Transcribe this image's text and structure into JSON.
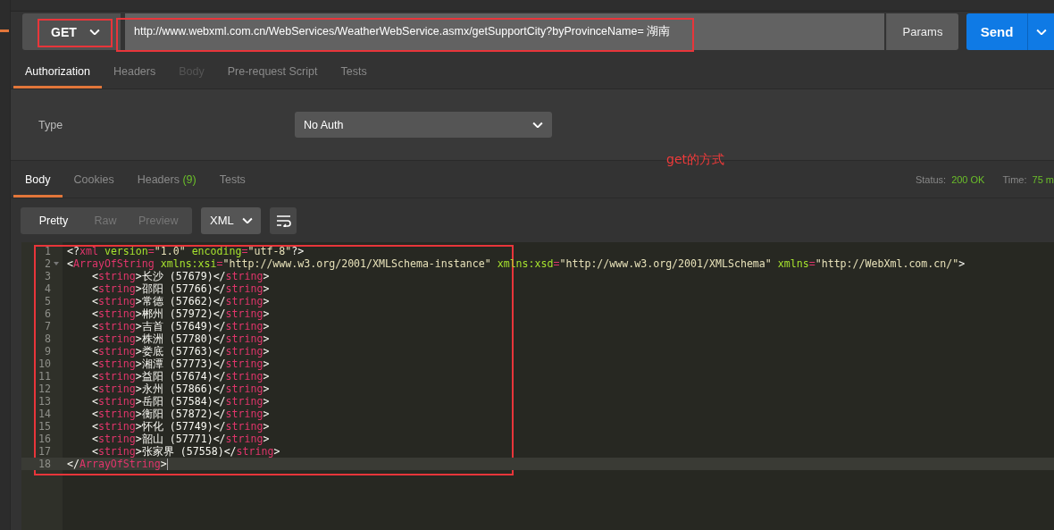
{
  "request": {
    "method": "GET",
    "method_highlighted": true,
    "url": "http://www.webxml.com.cn/WebServices/WeatherWebService.asmx/getSupportCity?byProvinceName= 湖南",
    "url_highlighted": true,
    "params_label": "Params",
    "send_label": "Send"
  },
  "request_tabs": [
    {
      "label": "Authorization",
      "selected": true,
      "disabled": false
    },
    {
      "label": "Headers",
      "selected": false,
      "disabled": false
    },
    {
      "label": "Body",
      "selected": false,
      "disabled": true
    },
    {
      "label": "Pre-request Script",
      "selected": false,
      "disabled": false
    },
    {
      "label": "Tests",
      "selected": false,
      "disabled": false
    }
  ],
  "authorization": {
    "type_label": "Type",
    "type_value": "No Auth"
  },
  "note": "get的方式",
  "response_tabs": [
    {
      "label": "Body",
      "selected": true
    },
    {
      "label": "Cookies",
      "selected": false
    },
    {
      "label": "Headers",
      "count": "(9)",
      "selected": false
    },
    {
      "label": "Tests",
      "selected": false
    }
  ],
  "status": {
    "status_label": "Status:",
    "status_value": "200 OK",
    "time_label": "Time:",
    "time_value": "75 m"
  },
  "view_modes": [
    {
      "label": "Pretty",
      "selected": true
    },
    {
      "label": "Raw",
      "selected": false
    },
    {
      "label": "Preview",
      "selected": false
    }
  ],
  "format": "XML",
  "editor": {
    "highlighted": true,
    "lines": [
      {
        "number": "1",
        "foldable": false,
        "current": false,
        "tokens": [
          {
            "kind": "punct",
            "text": "<?"
          },
          {
            "kind": "tag",
            "text": "xml"
          },
          {
            "kind": "attr",
            "text": " version"
          },
          {
            "kind": "eq",
            "text": "="
          },
          {
            "kind": "value",
            "text": "\"1.0\""
          },
          {
            "kind": "attr",
            "text": " encoding"
          },
          {
            "kind": "eq",
            "text": "="
          },
          {
            "kind": "value",
            "text": "\"utf-8\""
          },
          {
            "kind": "punct",
            "text": "?>"
          }
        ]
      },
      {
        "number": "2",
        "foldable": true,
        "current": false,
        "tokens": [
          {
            "kind": "punct",
            "text": "<"
          },
          {
            "kind": "tag",
            "text": "ArrayOfString"
          },
          {
            "kind": "attr",
            "text": " xmlns:xsi"
          },
          {
            "kind": "eq",
            "text": "="
          },
          {
            "kind": "value",
            "text": "\"http://www.w3.org/2001/XMLSchema-instance\""
          },
          {
            "kind": "attr",
            "text": " xmlns:xsd"
          },
          {
            "kind": "eq",
            "text": "="
          },
          {
            "kind": "value",
            "text": "\"http://www.w3.org/2001/XMLSchema\""
          },
          {
            "kind": "attr",
            "text": " xmlns"
          },
          {
            "kind": "eq",
            "text": "="
          },
          {
            "kind": "value",
            "text": "\"http://WebXml.com.cn/\""
          },
          {
            "kind": "punct",
            "text": ">"
          }
        ]
      },
      {
        "number": "3",
        "foldable": false,
        "current": false,
        "tokens": [
          {
            "kind": "punct",
            "text": "    <"
          },
          {
            "kind": "tag",
            "text": "string"
          },
          {
            "kind": "punct",
            "text": ">"
          },
          {
            "kind": "text",
            "text": "长沙 (57679)"
          },
          {
            "kind": "punct",
            "text": "</"
          },
          {
            "kind": "tag",
            "text": "string"
          },
          {
            "kind": "punct",
            "text": ">"
          }
        ]
      },
      {
        "number": "4",
        "foldable": false,
        "current": false,
        "tokens": [
          {
            "kind": "punct",
            "text": "    <"
          },
          {
            "kind": "tag",
            "text": "string"
          },
          {
            "kind": "punct",
            "text": ">"
          },
          {
            "kind": "text",
            "text": "邵阳 (57766)"
          },
          {
            "kind": "punct",
            "text": "</"
          },
          {
            "kind": "tag",
            "text": "string"
          },
          {
            "kind": "punct",
            "text": ">"
          }
        ]
      },
      {
        "number": "5",
        "foldable": false,
        "current": false,
        "tokens": [
          {
            "kind": "punct",
            "text": "    <"
          },
          {
            "kind": "tag",
            "text": "string"
          },
          {
            "kind": "punct",
            "text": ">"
          },
          {
            "kind": "text",
            "text": "常德 (57662)"
          },
          {
            "kind": "punct",
            "text": "</"
          },
          {
            "kind": "tag",
            "text": "string"
          },
          {
            "kind": "punct",
            "text": ">"
          }
        ]
      },
      {
        "number": "6",
        "foldable": false,
        "current": false,
        "tokens": [
          {
            "kind": "punct",
            "text": "    <"
          },
          {
            "kind": "tag",
            "text": "string"
          },
          {
            "kind": "punct",
            "text": ">"
          },
          {
            "kind": "text",
            "text": "郴州 (57972)"
          },
          {
            "kind": "punct",
            "text": "</"
          },
          {
            "kind": "tag",
            "text": "string"
          },
          {
            "kind": "punct",
            "text": ">"
          }
        ]
      },
      {
        "number": "7",
        "foldable": false,
        "current": false,
        "tokens": [
          {
            "kind": "punct",
            "text": "    <"
          },
          {
            "kind": "tag",
            "text": "string"
          },
          {
            "kind": "punct",
            "text": ">"
          },
          {
            "kind": "text",
            "text": "吉首 (57649)"
          },
          {
            "kind": "punct",
            "text": "</"
          },
          {
            "kind": "tag",
            "text": "string"
          },
          {
            "kind": "punct",
            "text": ">"
          }
        ]
      },
      {
        "number": "8",
        "foldable": false,
        "current": false,
        "tokens": [
          {
            "kind": "punct",
            "text": "    <"
          },
          {
            "kind": "tag",
            "text": "string"
          },
          {
            "kind": "punct",
            "text": ">"
          },
          {
            "kind": "text",
            "text": "株洲 (57780)"
          },
          {
            "kind": "punct",
            "text": "</"
          },
          {
            "kind": "tag",
            "text": "string"
          },
          {
            "kind": "punct",
            "text": ">"
          }
        ]
      },
      {
        "number": "9",
        "foldable": false,
        "current": false,
        "tokens": [
          {
            "kind": "punct",
            "text": "    <"
          },
          {
            "kind": "tag",
            "text": "string"
          },
          {
            "kind": "punct",
            "text": ">"
          },
          {
            "kind": "text",
            "text": "娄底 (57763)"
          },
          {
            "kind": "punct",
            "text": "</"
          },
          {
            "kind": "tag",
            "text": "string"
          },
          {
            "kind": "punct",
            "text": ">"
          }
        ]
      },
      {
        "number": "10",
        "foldable": false,
        "current": false,
        "tokens": [
          {
            "kind": "punct",
            "text": "    <"
          },
          {
            "kind": "tag",
            "text": "string"
          },
          {
            "kind": "punct",
            "text": ">"
          },
          {
            "kind": "text",
            "text": "湘潭 (57773)"
          },
          {
            "kind": "punct",
            "text": "</"
          },
          {
            "kind": "tag",
            "text": "string"
          },
          {
            "kind": "punct",
            "text": ">"
          }
        ]
      },
      {
        "number": "11",
        "foldable": false,
        "current": false,
        "tokens": [
          {
            "kind": "punct",
            "text": "    <"
          },
          {
            "kind": "tag",
            "text": "string"
          },
          {
            "kind": "punct",
            "text": ">"
          },
          {
            "kind": "text",
            "text": "益阳 (57674)"
          },
          {
            "kind": "punct",
            "text": "</"
          },
          {
            "kind": "tag",
            "text": "string"
          },
          {
            "kind": "punct",
            "text": ">"
          }
        ]
      },
      {
        "number": "12",
        "foldable": false,
        "current": false,
        "tokens": [
          {
            "kind": "punct",
            "text": "    <"
          },
          {
            "kind": "tag",
            "text": "string"
          },
          {
            "kind": "punct",
            "text": ">"
          },
          {
            "kind": "text",
            "text": "永州 (57866)"
          },
          {
            "kind": "punct",
            "text": "</"
          },
          {
            "kind": "tag",
            "text": "string"
          },
          {
            "kind": "punct",
            "text": ">"
          }
        ]
      },
      {
        "number": "13",
        "foldable": false,
        "current": false,
        "tokens": [
          {
            "kind": "punct",
            "text": "    <"
          },
          {
            "kind": "tag",
            "text": "string"
          },
          {
            "kind": "punct",
            "text": ">"
          },
          {
            "kind": "text",
            "text": "岳阳 (57584)"
          },
          {
            "kind": "punct",
            "text": "</"
          },
          {
            "kind": "tag",
            "text": "string"
          },
          {
            "kind": "punct",
            "text": ">"
          }
        ]
      },
      {
        "number": "14",
        "foldable": false,
        "current": false,
        "tokens": [
          {
            "kind": "punct",
            "text": "    <"
          },
          {
            "kind": "tag",
            "text": "string"
          },
          {
            "kind": "punct",
            "text": ">"
          },
          {
            "kind": "text",
            "text": "衡阳 (57872)"
          },
          {
            "kind": "punct",
            "text": "</"
          },
          {
            "kind": "tag",
            "text": "string"
          },
          {
            "kind": "punct",
            "text": ">"
          }
        ]
      },
      {
        "number": "15",
        "foldable": false,
        "current": false,
        "tokens": [
          {
            "kind": "punct",
            "text": "    <"
          },
          {
            "kind": "tag",
            "text": "string"
          },
          {
            "kind": "punct",
            "text": ">"
          },
          {
            "kind": "text",
            "text": "怀化 (57749)"
          },
          {
            "kind": "punct",
            "text": "</"
          },
          {
            "kind": "tag",
            "text": "string"
          },
          {
            "kind": "punct",
            "text": ">"
          }
        ]
      },
      {
        "number": "16",
        "foldable": false,
        "current": false,
        "tokens": [
          {
            "kind": "punct",
            "text": "    <"
          },
          {
            "kind": "tag",
            "text": "string"
          },
          {
            "kind": "punct",
            "text": ">"
          },
          {
            "kind": "text",
            "text": "韶山 (57771)"
          },
          {
            "kind": "punct",
            "text": "</"
          },
          {
            "kind": "tag",
            "text": "string"
          },
          {
            "kind": "punct",
            "text": ">"
          }
        ]
      },
      {
        "number": "17",
        "foldable": false,
        "current": false,
        "tokens": [
          {
            "kind": "punct",
            "text": "    <"
          },
          {
            "kind": "tag",
            "text": "string"
          },
          {
            "kind": "punct",
            "text": ">"
          },
          {
            "kind": "text",
            "text": "张家界 (57558)"
          },
          {
            "kind": "punct",
            "text": "</"
          },
          {
            "kind": "tag",
            "text": "string"
          },
          {
            "kind": "punct",
            "text": ">"
          }
        ]
      },
      {
        "number": "18",
        "foldable": false,
        "current": true,
        "tokens": [
          {
            "kind": "punct",
            "text": "</"
          },
          {
            "kind": "tag",
            "text": "ArrayOfString"
          },
          {
            "kind": "punct",
            "text": ">"
          }
        ]
      }
    ]
  }
}
